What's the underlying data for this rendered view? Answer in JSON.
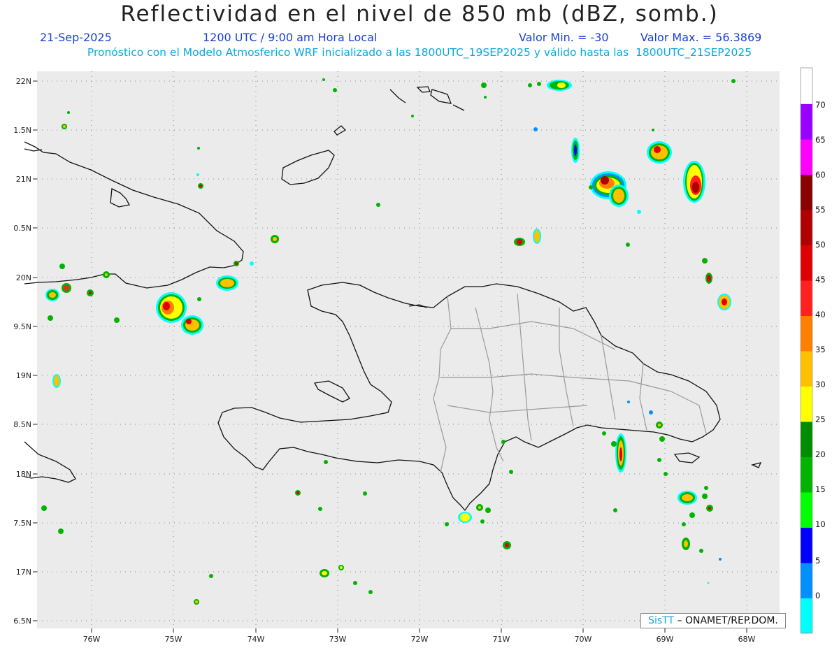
{
  "header": {
    "title": "Reflectividad en el nivel de 850 mb (dBZ, somb.)",
    "date": "21-Sep-2025",
    "time": "1200 UTC / 9:00 am Hora Local",
    "min_label": "Valor Min. = -30",
    "max_label": "Valor Max. = 56.3869",
    "forecast_line": "Pronóstico con el Modelo Atmosferico WRF inicializado a las 1800UTC_19SEP2025 y válido hasta las  1800UTC_21SEP2025"
  },
  "map": {
    "lat_ticks": [
      "22N",
      "1.5N",
      "21N",
      "0.5N",
      "20N",
      "9.5N",
      "19N",
      "8.5N",
      "18N",
      "7.5N",
      "17N",
      "6.5N"
    ],
    "lon_ticks": [
      "76W",
      "75W",
      "74W",
      "73W",
      "72W",
      "71W",
      "70W",
      "69W",
      "68W"
    ],
    "ocean_color": "#ebebeb"
  },
  "colorbar": {
    "labels": [
      "70",
      "65",
      "60",
      "55",
      "50",
      "45",
      "40",
      "35",
      "30",
      "25",
      "20",
      "15",
      "10",
      "5",
      "0"
    ],
    "colors": [
      "#9a00ff",
      "#ff00ff",
      "#8b0000",
      "#b00000",
      "#e00000",
      "#ff2020",
      "#ff7f00",
      "#ffc000",
      "#ffff00",
      "#008c00",
      "#00b400",
      "#00ff00",
      "#0000ff",
      "#0090ff",
      "#00ffff",
      "#e6e6e6"
    ]
  },
  "credit": {
    "brand": "SisTT",
    "org": "– ONAMET/REP.DOM."
  }
}
